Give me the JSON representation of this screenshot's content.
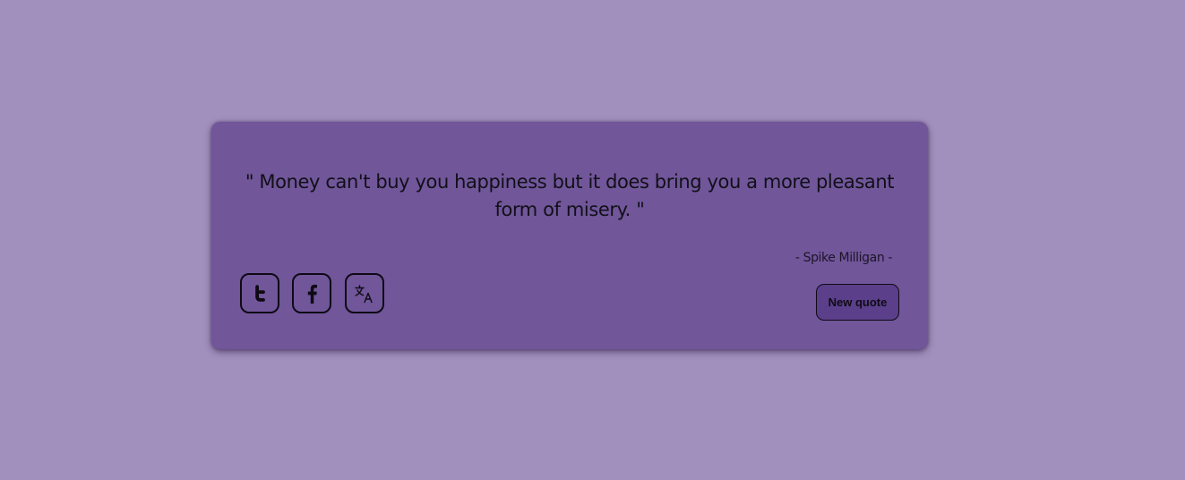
{
  "quote": {
    "text": "\" Money can't buy you happiness but it does bring you a more pleasant form of misery. \"",
    "author": "- Spike Milligan -"
  },
  "actions": {
    "twitter_icon": "twitter-icon",
    "facebook_icon": "facebook-icon",
    "translate_icon": "translate-icon",
    "new_quote_label": "New quote"
  },
  "colors": {
    "page_background": "#a18fbd",
    "card_background": "#71569a",
    "button_background": "#5b3f8a",
    "text": "#111018"
  }
}
